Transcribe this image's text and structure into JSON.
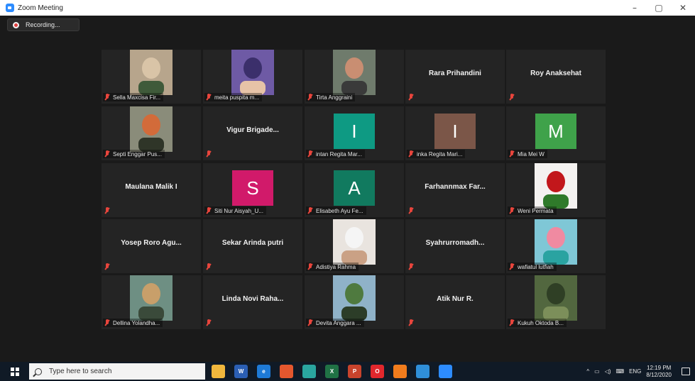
{
  "window": {
    "title": "Zoom Meeting",
    "controls": [
      "–",
      "▢",
      "✕"
    ]
  },
  "recording": {
    "label": "Recording..."
  },
  "participants": [
    {
      "display": "video",
      "name": "Sella Maxcisa Fir...",
      "photo_theme": "person-mask-hijab"
    },
    {
      "display": "video",
      "name": "meita puspita m...",
      "photo_theme": "person-purple-hijab"
    },
    {
      "display": "video",
      "name": "Tirta Anggraini",
      "photo_theme": "person-closeup"
    },
    {
      "display": "name",
      "name": "Rara Prihandini"
    },
    {
      "display": "name",
      "name": "Roy Anaksehat"
    },
    {
      "display": "video",
      "name": "Septi Enggar Pus...",
      "photo_theme": "person-orange"
    },
    {
      "display": "name",
      "name": "Vigur Brigade..."
    },
    {
      "display": "initial",
      "initial": "I",
      "color": "#0e9a83",
      "name": "intan Regita Mar..."
    },
    {
      "display": "initial",
      "initial": "I",
      "color": "#7b5648",
      "name": "inka Regita Mari..."
    },
    {
      "display": "initial",
      "initial": "M",
      "color": "#3fa24a",
      "name": "Mia Mei W"
    },
    {
      "display": "name",
      "name": "Maulana Malik I"
    },
    {
      "display": "initial",
      "initial": "S",
      "color": "#d11a6a",
      "name": "Siti Nur Aisyah_U..."
    },
    {
      "display": "initial",
      "initial": "A",
      "color": "#117a5f",
      "name": "Elisabeth Ayu Fe..."
    },
    {
      "display": "name",
      "name": "Farhannmax Far..."
    },
    {
      "display": "image",
      "name": "Weni Permata",
      "photo_theme": "red-roses"
    },
    {
      "display": "name",
      "name": "Yosep Roro Agu..."
    },
    {
      "display": "name",
      "name": "Sekar Arinda putri"
    },
    {
      "display": "image",
      "name": "Adistiya Rahma",
      "photo_theme": "person-white-hijab"
    },
    {
      "display": "name",
      "name": "Syahrurromadh..."
    },
    {
      "display": "image",
      "name": "wafiatul lutfiah",
      "photo_theme": "eiffel-illustration"
    },
    {
      "display": "video",
      "name": "Dellina Yolandha...",
      "photo_theme": "person-outdoor"
    },
    {
      "display": "name",
      "name": "Linda Novi Raha..."
    },
    {
      "display": "image",
      "name": "Devita Anggara ...",
      "photo_theme": "trees-outdoor"
    },
    {
      "display": "name",
      "name": "Atik Nur R."
    },
    {
      "display": "image",
      "name": "Kukuh Oktoda B...",
      "photo_theme": "forest"
    }
  ],
  "taskbar": {
    "search_placeholder": "Type here to search",
    "apps": [
      {
        "name": "file-explorer-icon",
        "label": "",
        "color": "#f0b73d"
      },
      {
        "name": "word-icon",
        "label": "W",
        "color": "#2b5fb4"
      },
      {
        "name": "edge-icon",
        "label": "e",
        "color": "#1e7ad6"
      },
      {
        "name": "office-icon",
        "label": "",
        "color": "#e4572e"
      },
      {
        "name": "search-app-icon",
        "label": "",
        "color": "#2aa6a0"
      },
      {
        "name": "excel-icon",
        "label": "X",
        "color": "#207245"
      },
      {
        "name": "powerpoint-icon",
        "label": "P",
        "color": "#c8432c"
      },
      {
        "name": "opera-icon",
        "label": "O",
        "color": "#e0272d"
      },
      {
        "name": "firefox-icon",
        "label": "",
        "color": "#f07c1d"
      },
      {
        "name": "store-icon",
        "label": "",
        "color": "#2f8fd9"
      },
      {
        "name": "zoom-icon",
        "label": "",
        "color": "#2d8cff"
      }
    ],
    "tray": {
      "chevron": "^",
      "lang": "ENG",
      "time": "12:19 PM",
      "date": "8/12/2020"
    }
  }
}
